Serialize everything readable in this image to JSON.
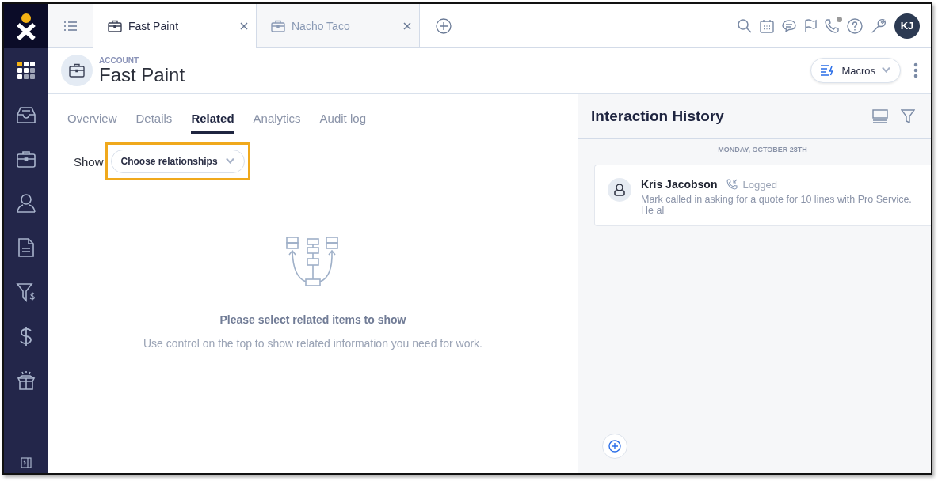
{
  "tabs": [
    {
      "label": "Fast Paint",
      "selected": true
    },
    {
      "label": "Nacho Taco",
      "selected": false
    }
  ],
  "top_bar": {
    "call_indicator": true,
    "avatar_initials": "KJ"
  },
  "header": {
    "type_label": "ACCOUNT",
    "title": "Fast Paint",
    "macros_button": "Macros"
  },
  "detail_tabs": [
    {
      "label": "Overview",
      "selected": false
    },
    {
      "label": "Details",
      "selected": false
    },
    {
      "label": "Related",
      "selected": true
    },
    {
      "label": "Analytics",
      "selected": false
    },
    {
      "label": "Audit log",
      "selected": false
    }
  ],
  "filter": {
    "label": "Show",
    "dropdown": "Choose relationships",
    "highlighted": true
  },
  "empty_state": {
    "title": "Please select related items to show",
    "message": "Use control on the top to show related information you need for work."
  },
  "interaction_history": {
    "title": "Interaction History",
    "date_divider": "MONDAY, OCTOBER 28TH",
    "entries": [
      {
        "name": "Kris Jacobson",
        "status": "Logged",
        "text": "Mark called in asking for a quote for 10 lines with Pro Service. He al"
      }
    ]
  }
}
